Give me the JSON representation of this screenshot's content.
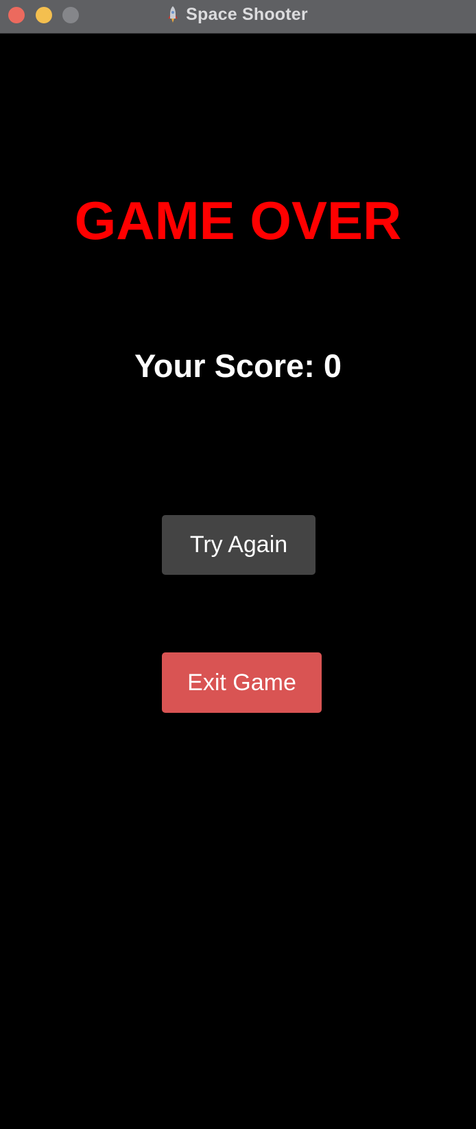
{
  "window": {
    "title": "Space Shooter",
    "icon": "rocket-icon",
    "traffic_lights": {
      "close_color": "#ec6a5e",
      "minimize_color": "#f4bf4f",
      "zoom_color": "#85868a"
    }
  },
  "screen": {
    "heading": "GAME OVER",
    "heading_color": "#ff0000",
    "score_label": "Your Score: 0",
    "background_color": "#000000"
  },
  "buttons": {
    "try_again": {
      "label": "Try Again",
      "color": "#444444"
    },
    "exit": {
      "label": "Exit Game",
      "color": "#d95453"
    }
  }
}
